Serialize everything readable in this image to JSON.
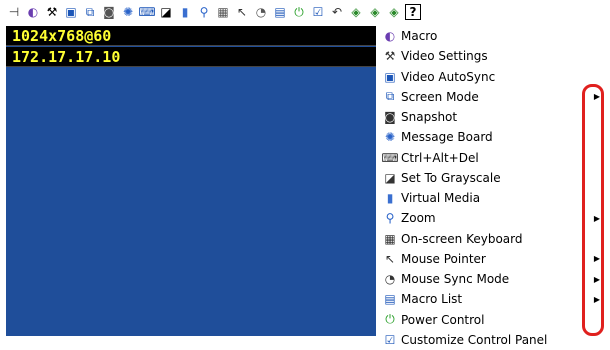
{
  "toolbar": {
    "icons": [
      {
        "name": "pin-icon",
        "glyph": "⊣"
      },
      {
        "name": "macro-icon",
        "glyph": "◐"
      },
      {
        "name": "hammer-icon",
        "glyph": "⚒"
      },
      {
        "name": "video-autosync-icon",
        "glyph": "▣"
      },
      {
        "name": "screen-mode-icon",
        "glyph": "⧉"
      },
      {
        "name": "camera-icon",
        "glyph": "◙"
      },
      {
        "name": "message-board-icon",
        "glyph": "✺"
      },
      {
        "name": "ctrl-alt-del-icon",
        "glyph": "⌨"
      },
      {
        "name": "grayscale-icon",
        "glyph": "◪"
      },
      {
        "name": "virtual-media-icon",
        "glyph": "▮"
      },
      {
        "name": "zoom-icon",
        "glyph": "⚲"
      },
      {
        "name": "keyboard-icon",
        "glyph": "▦"
      },
      {
        "name": "mouse-pointer-icon",
        "glyph": "↖"
      },
      {
        "name": "mouse-sync-icon",
        "glyph": "◔"
      },
      {
        "name": "macro-list-icon",
        "glyph": "▤"
      },
      {
        "name": "power-icon",
        "glyph": "⏻"
      },
      {
        "name": "customize-panel-icon",
        "glyph": "☑"
      },
      {
        "name": "exit-icon",
        "glyph": "↶"
      },
      {
        "name": "record-icon-1",
        "glyph": "◈"
      },
      {
        "name": "record-icon-2",
        "glyph": "◈"
      },
      {
        "name": "record-icon-3",
        "glyph": "◈"
      },
      {
        "name": "help-icon",
        "glyph": "?"
      }
    ]
  },
  "info": {
    "resolution": "1024x768@60",
    "ip": "172.17.17.10"
  },
  "menu": {
    "items": [
      {
        "label": "Macro",
        "icon": "macro-icon",
        "glyph": "◐",
        "submenu": false
      },
      {
        "label": "Video Settings",
        "icon": "hammer-icon",
        "glyph": "⚒",
        "submenu": false
      },
      {
        "label": "Video AutoSync",
        "icon": "video-autosync-icon",
        "glyph": "▣",
        "submenu": false
      },
      {
        "label": "Screen Mode",
        "icon": "screen-mode-icon",
        "glyph": "⧉",
        "submenu": true
      },
      {
        "label": "Snapshot",
        "icon": "camera-icon",
        "glyph": "◙",
        "submenu": false
      },
      {
        "label": "Message Board",
        "icon": "message-board-icon",
        "glyph": "✺",
        "submenu": false
      },
      {
        "label": "Ctrl+Alt+Del",
        "icon": "ctrl-alt-del-icon",
        "glyph": "⌨",
        "submenu": false
      },
      {
        "label": "Set To Grayscale",
        "icon": "grayscale-icon",
        "glyph": "◪",
        "submenu": false
      },
      {
        "label": "Virtual Media",
        "icon": "virtual-media-icon",
        "glyph": "▮",
        "submenu": false
      },
      {
        "label": "Zoom",
        "icon": "zoom-icon",
        "glyph": "⚲",
        "submenu": true
      },
      {
        "label": "On-screen Keyboard",
        "icon": "keyboard-icon",
        "glyph": "▦",
        "submenu": false
      },
      {
        "label": "Mouse Pointer",
        "icon": "mouse-pointer-icon",
        "glyph": "↖",
        "submenu": true
      },
      {
        "label": "Mouse Sync Mode",
        "icon": "mouse-sync-icon",
        "glyph": "◔",
        "submenu": true
      },
      {
        "label": "Macro List",
        "icon": "macro-list-icon",
        "glyph": "▤",
        "submenu": true
      },
      {
        "label": "Power Control",
        "icon": "power-icon",
        "glyph": "⏻",
        "submenu": false
      },
      {
        "label": "Customize Control Panel",
        "icon": "customize-panel-icon",
        "glyph": "☑",
        "submenu": false
      }
    ],
    "submenu_arrow": "▶"
  },
  "colors": {
    "remote_background": "#1f4e9a",
    "info_text": "#ffff33",
    "highlight": "#e0201e"
  }
}
